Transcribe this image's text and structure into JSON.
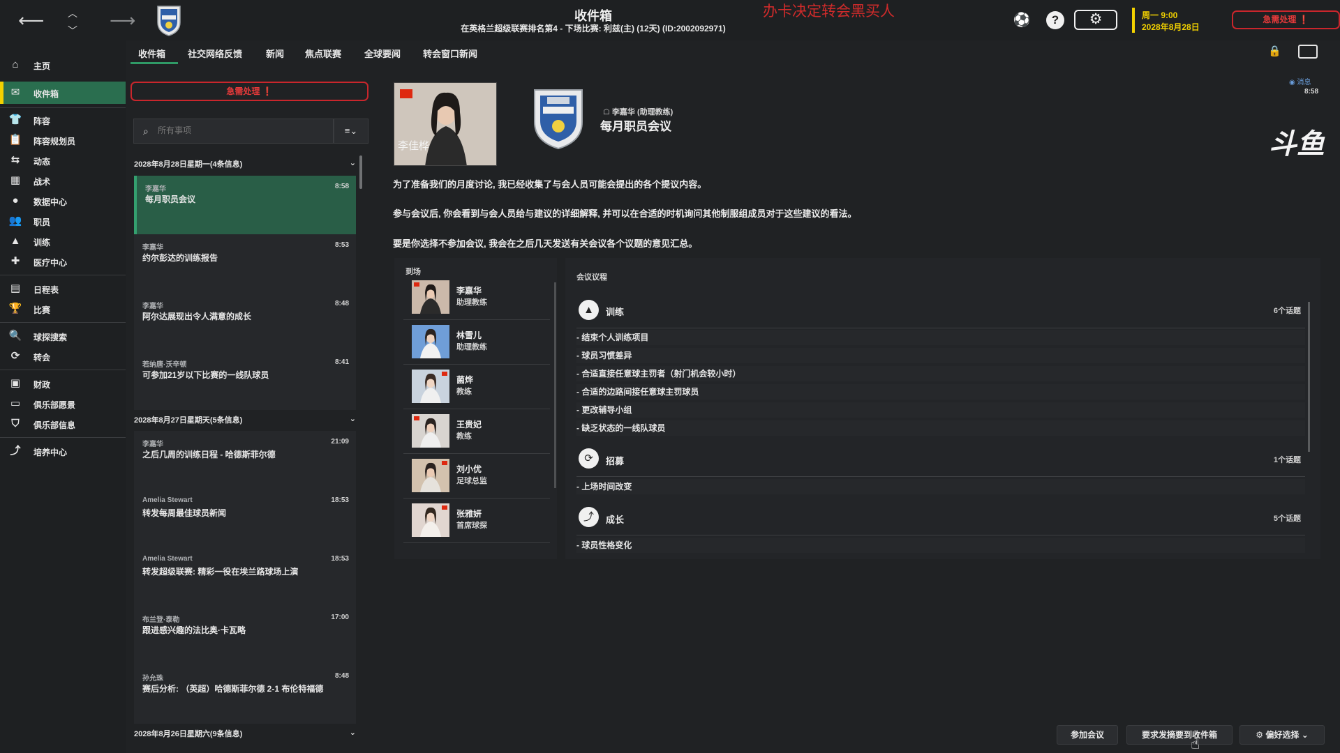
{
  "header": {
    "title": "收件箱",
    "subtitle": "在英格兰超级联赛排名第4 - 下场比赛: 利兹(主) (12天) (ID:2002092971)",
    "overlay_text": "办卡决定转会黑买人",
    "date_line1": "周一 9:00",
    "date_line2": "2028年8月28日",
    "urgent_label": "急需处理"
  },
  "sidebar": {
    "items": [
      {
        "label": "主页",
        "icon": "home-icon"
      },
      {
        "label": "收件箱",
        "icon": "inbox-icon"
      },
      {
        "label": "阵容",
        "icon": "shirt-icon"
      },
      {
        "label": "阵容规划员",
        "icon": "clipboard-icon"
      },
      {
        "label": "动态",
        "icon": "dynamics-icon"
      },
      {
        "label": "战术",
        "icon": "tactics-icon"
      },
      {
        "label": "数据中心",
        "icon": "data-icon"
      },
      {
        "label": "职员",
        "icon": "staff-icon"
      },
      {
        "label": "训练",
        "icon": "training-icon"
      },
      {
        "label": "医疗中心",
        "icon": "medical-icon"
      },
      {
        "label": "日程表",
        "icon": "calendar-icon"
      },
      {
        "label": "比赛",
        "icon": "trophy-icon"
      },
      {
        "label": "球探搜索",
        "icon": "scout-icon"
      },
      {
        "label": "转会",
        "icon": "transfer-icon"
      },
      {
        "label": "财政",
        "icon": "finance-icon"
      },
      {
        "label": "俱乐部愿景",
        "icon": "vision-icon"
      },
      {
        "label": "俱乐部信息",
        "icon": "shield-icon"
      },
      {
        "label": "培养中心",
        "icon": "development-icon"
      }
    ]
  },
  "tabs": [
    "收件箱",
    "社交网络反馈",
    "新闻",
    "焦点联赛",
    "全球要闻",
    "转会窗口新闻"
  ],
  "inbox": {
    "urgent_label": "急需处理",
    "search_placeholder": "所有事项",
    "groups": [
      {
        "date": "2028年8月28日星期一(4条信息)"
      },
      {
        "date": "2028年8月27日星期天(5条信息)"
      },
      {
        "date": "2028年8月26日星期六(9条信息)"
      }
    ],
    "messages": [
      {
        "sender": "李嘉华",
        "time": "8:58",
        "subject": "每月职员会议"
      },
      {
        "sender": "李嘉华",
        "time": "8:53",
        "subject": "约尔彭达的训练报告"
      },
      {
        "sender": "李嘉华",
        "time": "8:48",
        "subject": "阿尔达展现出令人满意的成长"
      },
      {
        "sender": "若纳唐·沃辛顿",
        "time": "8:41",
        "subject": "可参加21岁以下比赛的一线队球员"
      },
      {
        "sender": "李嘉华",
        "time": "21:09",
        "subject": "之后几周的训练日程 - 哈德斯菲尔德"
      },
      {
        "sender": "Amelia Stewart",
        "time": "18:53",
        "subject": "转发每周最佳球员新闻"
      },
      {
        "sender": "Amelia Stewart",
        "time": "18:53",
        "subject": "转发超级联赛: 精彩一役在埃兰路球场上演"
      },
      {
        "sender": "布兰登·泰勒",
        "time": "17:00",
        "subject": "跟进感兴趣的法比奥·卡瓦略"
      },
      {
        "sender": "孙允珠",
        "time": "8:48",
        "subject": "赛后分析: （英超）哈德斯菲尔德 2-1 布伦特福德"
      }
    ]
  },
  "message": {
    "photo_name": "李佳桦",
    "sender_line": "李嘉华 (助理教练)",
    "title": "每月职员会议",
    "tag": "消息",
    "time": "8:58",
    "watermark": "斗鱼",
    "paragraphs": [
      "为了准备我们的月度讨论, 我已经收集了与会人员可能会提出的各个提议内容。",
      "参与会议后, 你会看到与会人员给与建议的详细解释, 并可以在合适的时机询问其他制服组成员对于这些建议的看法。",
      "要是你选择不参加会议, 我会在之后几天发送有关会议各个议题的意见汇总。"
    ],
    "attendance_title": "到场",
    "attendees": [
      {
        "name": "李嘉华",
        "role": "助理教练"
      },
      {
        "name": "林雪儿",
        "role": "助理教练"
      },
      {
        "name": "菌烨",
        "role": "教练"
      },
      {
        "name": "王贵妃",
        "role": "教练"
      },
      {
        "name": "刘小优",
        "role": "足球总监"
      },
      {
        "name": "张雅妍",
        "role": "首席球探"
      }
    ],
    "agenda_title": "会议议程",
    "agenda": [
      {
        "category": "训练",
        "count": "6个话题",
        "icon": "training-icon",
        "items": [
          "- 结束个人训练项目",
          "- 球员习惯差异",
          "- 合适直接任意球主罚者（射门机会较小时）",
          "- 合适的边路间接任意球主罚球员",
          "- 更改辅导小组",
          "- 缺乏状态的一线队球员"
        ]
      },
      {
        "category": "招募",
        "count": "1个话题",
        "icon": "recruit-icon",
        "items": [
          "- 上场时间改变"
        ]
      },
      {
        "category": "成长",
        "count": "5个话题",
        "icon": "growth-icon",
        "items": [
          "- 球员性格变化"
        ]
      }
    ]
  },
  "actions": {
    "attend": "参加会议",
    "summary": "要求发摘要到收件箱",
    "prefs": "偏好选择"
  }
}
